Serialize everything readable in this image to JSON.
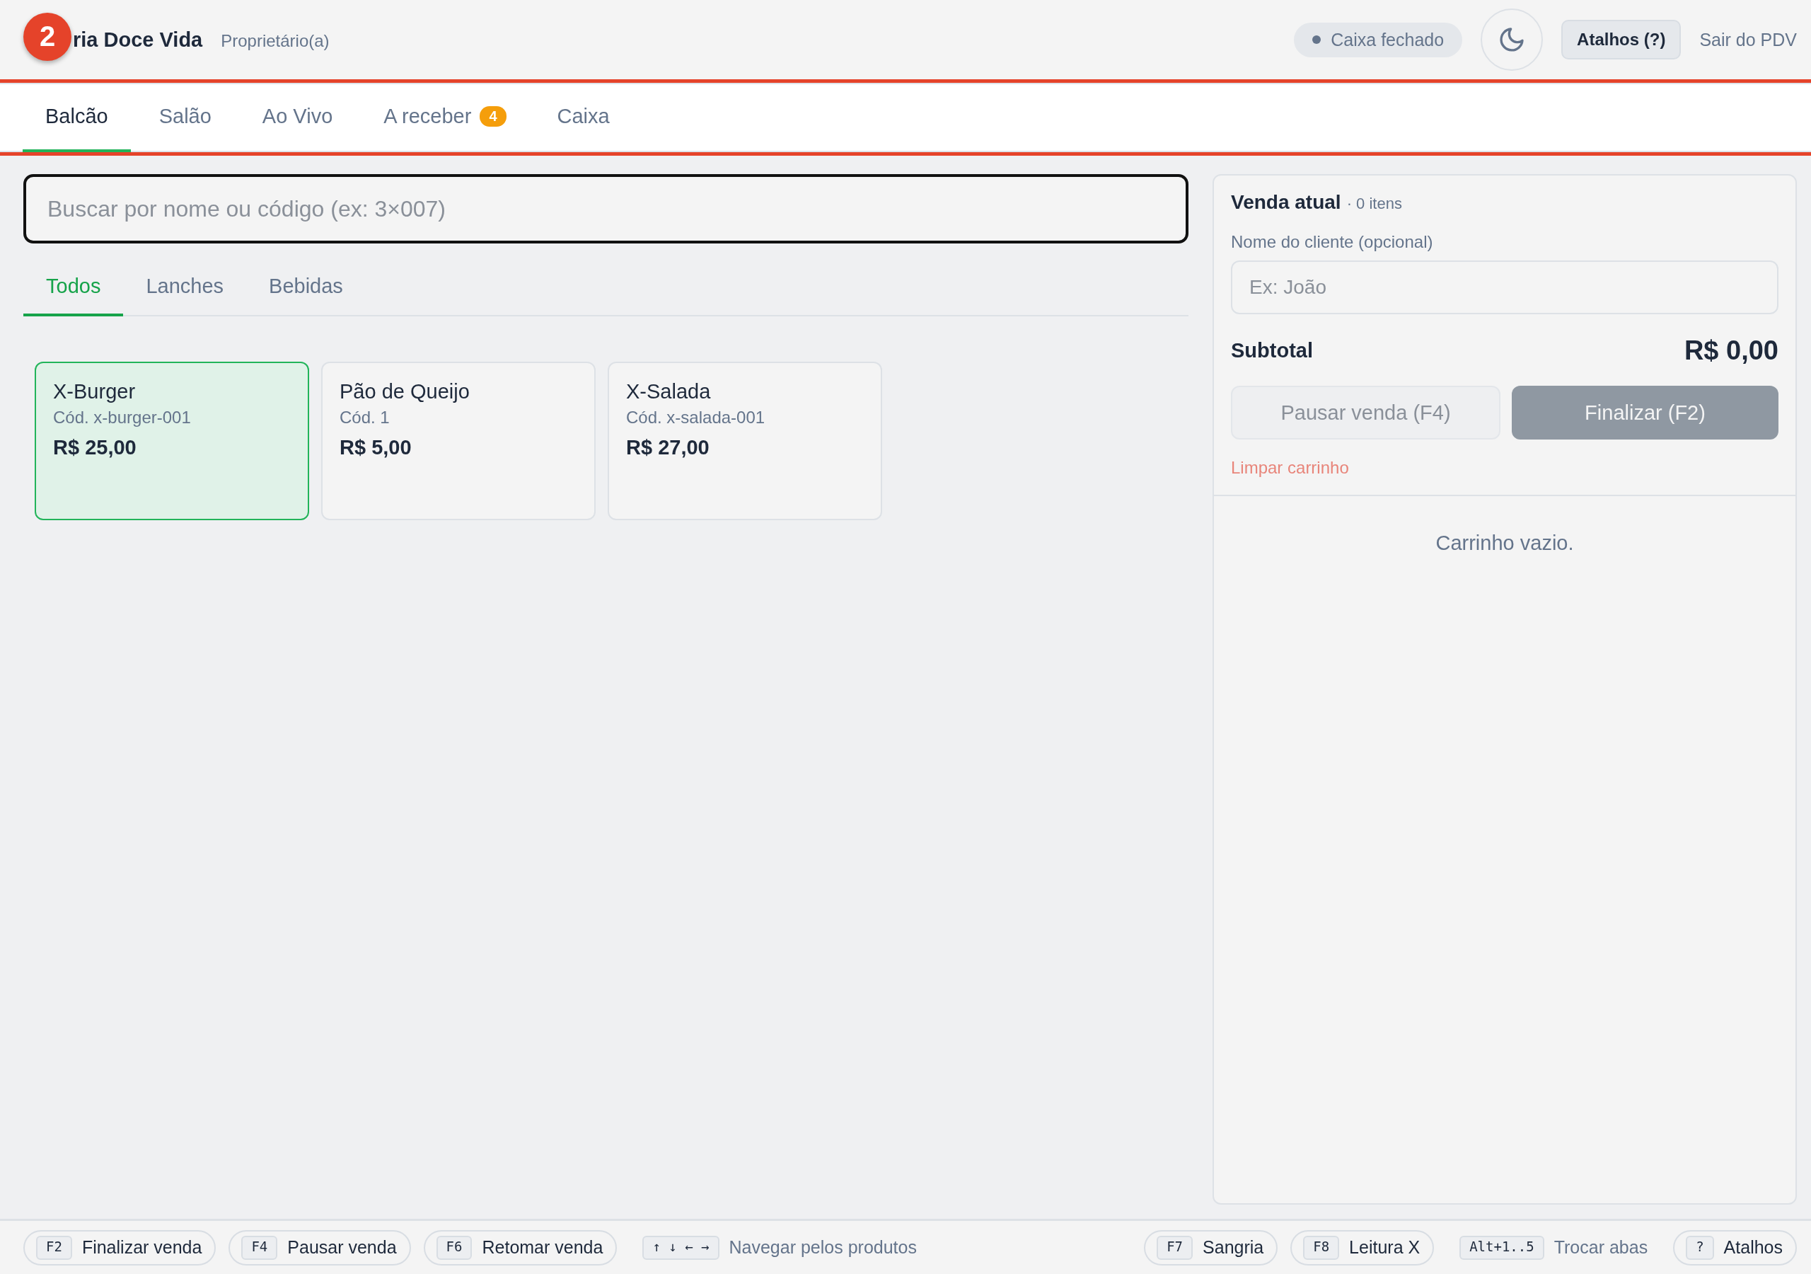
{
  "annotation": {
    "number": "2"
  },
  "header": {
    "title": "ria Doce Vida",
    "role": "Proprietário(a)",
    "status": "Caixa fechado",
    "shortcuts_button": "Atalhos (?)",
    "exit_link": "Sair do PDV"
  },
  "tabs": [
    {
      "label": "Balcão",
      "selected": true
    },
    {
      "label": "Salão",
      "selected": false
    },
    {
      "label": "Ao Vivo",
      "selected": false
    },
    {
      "label": "A receber",
      "selected": false,
      "badge": "4"
    },
    {
      "label": "Caixa",
      "selected": false
    }
  ],
  "search": {
    "placeholder": "Buscar por nome ou código (ex: 3×007)"
  },
  "categories": [
    {
      "label": "Todos",
      "selected": true
    },
    {
      "label": "Lanches",
      "selected": false
    },
    {
      "label": "Bebidas",
      "selected": false
    }
  ],
  "products": [
    {
      "name": "X-Burger",
      "code": "Cód. x-burger-001",
      "price": "R$ 25,00",
      "selected": true
    },
    {
      "name": "Pão de Queijo",
      "code": "Cód. 1",
      "price": "R$ 5,00",
      "selected": false
    },
    {
      "name": "X-Salada",
      "code": "Cód. x-salada-001",
      "price": "R$ 27,00",
      "selected": false
    }
  ],
  "sale": {
    "title": "Venda atual",
    "count": "· 0 itens",
    "customer_label": "Nome do cliente (opcional)",
    "customer_placeholder": "Ex: João",
    "subtotal_label": "Subtotal",
    "subtotal": "R$ 0,00",
    "pause_button": "Pausar venda (F4)",
    "finish_button": "Finalizar (F2)",
    "buttons_disabled": true,
    "clear_link": "Limpar carrinho",
    "empty_text": "Carrinho vazio."
  },
  "shortcuts": [
    {
      "kind": "pill",
      "key": "F2",
      "label": "Finalizar venda"
    },
    {
      "kind": "pill",
      "key": "F4",
      "label": "Pausar venda"
    },
    {
      "kind": "pill",
      "key": "F6",
      "label": "Retomar venda"
    },
    {
      "kind": "plain",
      "key": "↑ ↓ ← →",
      "label": "Navegar pelos produtos"
    },
    {
      "kind": "spacer"
    },
    {
      "kind": "pill",
      "key": "F7",
      "label": "Sangria"
    },
    {
      "kind": "pill",
      "key": "F8",
      "label": "Leitura X"
    },
    {
      "kind": "plain",
      "key": "Alt+1..5",
      "label": "Trocar abas"
    },
    {
      "kind": "pill",
      "key": "?",
      "label": "Atalhos"
    }
  ]
}
